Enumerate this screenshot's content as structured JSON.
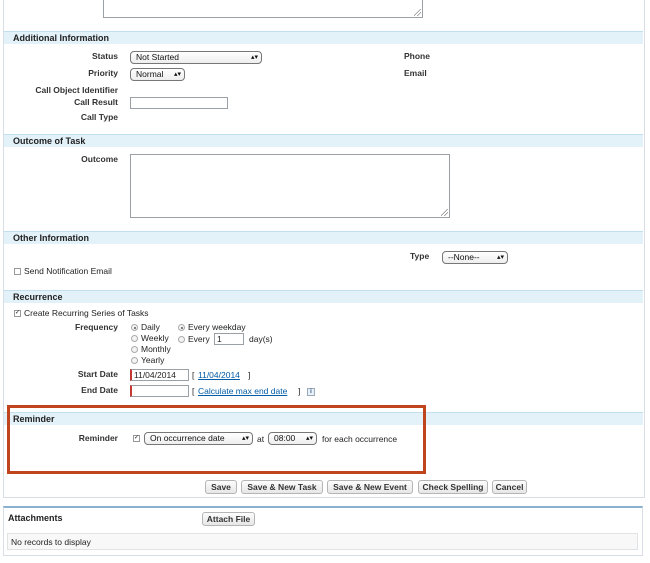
{
  "sections": {
    "additional_info": "Additional Information",
    "outcome": "Outcome of Task",
    "other_info": "Other Information",
    "recurrence": "Recurrence",
    "reminder": "Reminder",
    "attachments": "Attachments"
  },
  "additional": {
    "status_label": "Status",
    "status_value": "Not Started",
    "priority_label": "Priority",
    "priority_value": "Normal",
    "call_object_label": "Call Object Identifier",
    "call_result_label": "Call Result",
    "call_type_label": "Call Type",
    "phone_label": "Phone",
    "email_label": "Email"
  },
  "outcome": {
    "label": "Outcome"
  },
  "other": {
    "type_label": "Type",
    "type_value": "--None--",
    "send_notification_label": "Send Notification Email"
  },
  "recurrence": {
    "create_label": "Create Recurring Series of Tasks",
    "frequency_label": "Frequency",
    "freq_daily": "Daily",
    "freq_weekly": "Weekly",
    "freq_monthly": "Monthly",
    "freq_yearly": "Yearly",
    "every_weekday": "Every weekday",
    "every_label": "Every",
    "every_value": "1",
    "days_label": "day(s)",
    "start_date_label": "Start Date",
    "start_date_value": "11/04/2014",
    "start_date_link": "11/04/2014",
    "end_date_label": "End Date",
    "calc_link": "Calculate max end date",
    "bracket_open": "[",
    "bracket_close": "]",
    "info_icon": "i"
  },
  "reminder": {
    "label": "Reminder",
    "when_value": "On occurrence date",
    "at_label": "at",
    "time_value": "08:00",
    "suffix": "for each occurrence"
  },
  "buttons": {
    "save": "Save",
    "save_new_task": "Save & New Task",
    "save_new_event": "Save & New Event",
    "check_spelling": "Check Spelling",
    "cancel": "Cancel",
    "attach_file": "Attach File"
  },
  "attachments": {
    "empty": "No records to display"
  },
  "colors": {
    "section_bg": "#e3f1f9",
    "required": "#c23934",
    "highlight": "#c0441e",
    "link": "#015ba7"
  }
}
